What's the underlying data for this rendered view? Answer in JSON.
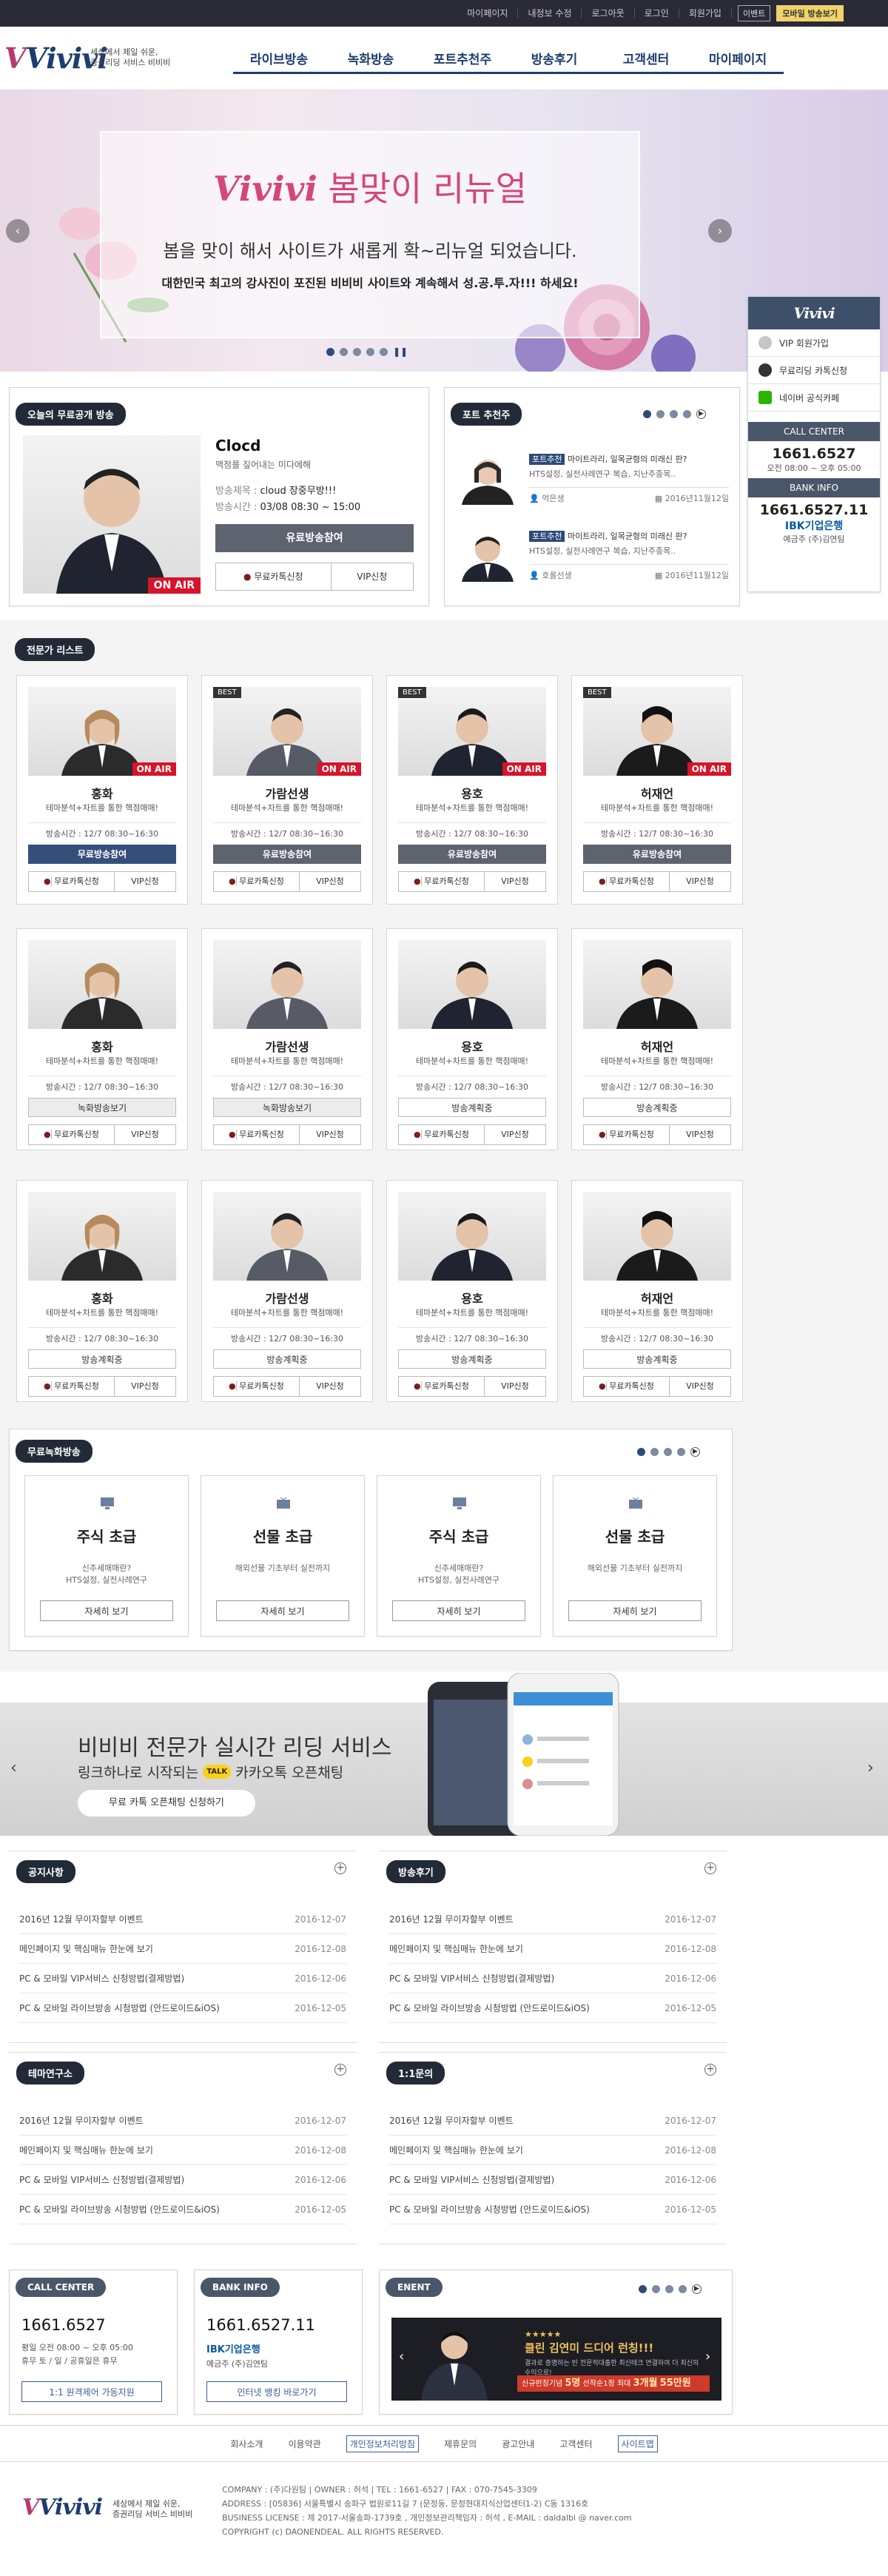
{
  "topbar": {
    "links": [
      "마이페이지",
      "내정보 수정",
      "로그아웃",
      "로그인",
      "회원가입"
    ],
    "event_label": "이벤트",
    "mobile_label": "모바일 방송보기"
  },
  "header": {
    "logo": "Vivivi",
    "tagline_1": "세상에서 제일 쉬운,",
    "tagline_2": "증권리딩 서비스 비비비",
    "nav": [
      "라이브방송",
      "녹화방송",
      "포트추천주",
      "방송후기",
      "고객센터",
      "마이페이지"
    ]
  },
  "banner": {
    "title_brand": "Vivivi",
    "title_rest": "봄맞이 리뉴얼",
    "line1": "봄을 맞이 해서 사이트가 새롭게 확~리뉴얼 되었습니다.",
    "line2": "대한민국 최고의 강사진이 포진된 비비비 사이트와 계속해서 성.공.투.자!!! 하세요!",
    "pause_icon": "pause-icon"
  },
  "quick": {
    "logo": "Vivivi",
    "items": [
      "VIP 회원가입",
      "무료리딩 카톡신청",
      "네이버 공식카페"
    ],
    "call_center_label": "CALL CENTER",
    "call_number": "1661.6527",
    "call_hours": "오전 08:00 ~ 오후 05:00",
    "bank_label": "BANK INFO",
    "bank_number": "1661.6527.11",
    "bank_name": "IBK기업은행",
    "bank_holder_label": "예금주",
    "bank_holder": "(주)김연팀"
  },
  "free_live": {
    "heading": "오늘의 무료공개 방송",
    "name": "Clocd",
    "desc": "맥점를 짚어내는 미다에해",
    "title_label": "방송제목 : ",
    "title_value": "cloud 장중무방!!!",
    "time_label": "방송시간 : ",
    "time_value": "03/08  08:30 ~ 15:00",
    "onair": "ON AIR",
    "join_button": "유료방송참여",
    "kakao_button": "무료카톡신청",
    "vip_button": "VIP신청"
  },
  "port": {
    "heading": "포트 추천주",
    "items": [
      {
        "tag": "포트추천",
        "title": "마이트라리, 일목균형의 미래신 판?",
        "sub": "HTS설정, 실전사례연구 복습, 지난주종목..",
        "author": "먹은생",
        "date": "2016년11월12일"
      },
      {
        "tag": "포트추천",
        "title": "마이트라리, 일목균형의 미래신 판?",
        "sub": "HTS설정, 실전사례연구 복습, 지난주종목..",
        "author": "호롤선생",
        "date": "2016년11월12일"
      }
    ]
  },
  "experts": {
    "heading": "전문가 리스트",
    "desc": "테마분석+차트를 통한 핵점매매!",
    "time": "방송시간 : 12/7 08:30~16:30",
    "kakao": "무료카톡신청",
    "vip": "VIP신청",
    "best": "BEST",
    "onair": "ON AIR",
    "rows": [
      [
        {
          "name": "홍화",
          "button": "무료방송참여",
          "style": "navy",
          "onair": true,
          "best": false
        },
        {
          "name": "가람선생",
          "button": "유료방송참여",
          "style": "dark",
          "onair": true,
          "best": true
        },
        {
          "name": "용호",
          "button": "유료방송참여",
          "style": "dark",
          "onair": true,
          "best": true
        },
        {
          "name": "허재언",
          "button": "유료방송참여",
          "style": "dark",
          "onair": true,
          "best": true
        }
      ],
      [
        {
          "name": "홍화",
          "button": "녹화방송보기",
          "style": "ghost",
          "onair": false,
          "best": false
        },
        {
          "name": "가람선생",
          "button": "녹화방송보기",
          "style": "ghost",
          "onair": false,
          "best": false
        },
        {
          "name": "용호",
          "button": "방송계획중",
          "style": "line",
          "onair": false,
          "best": false
        },
        {
          "name": "허재언",
          "button": "방송계획중",
          "style": "line",
          "onair": false,
          "best": false
        }
      ],
      [
        {
          "name": "홍화",
          "button": "방송계획중",
          "style": "line",
          "onair": false,
          "best": false
        },
        {
          "name": "가람선생",
          "button": "방송계획중",
          "style": "line",
          "onair": false,
          "best": false
        },
        {
          "name": "용호",
          "button": "방송계획중",
          "style": "line",
          "onair": false,
          "best": false
        },
        {
          "name": "허재언",
          "button": "방송계획중",
          "style": "line",
          "onair": false,
          "best": false
        }
      ]
    ]
  },
  "recorded": {
    "heading": "무료녹화방송",
    "items": [
      {
        "title": "주식 초급",
        "d1": "신추세매매란?",
        "d2": "HTS설정, 실전사례연구",
        "button": "자세히 보기"
      },
      {
        "title": "선물 초급",
        "d1": "해외선물 기초부터 실전까지",
        "d2": "",
        "button": "자세히 보기"
      },
      {
        "title": "주식 초급",
        "d1": "신추세매매란?",
        "d2": "HTS설정, 실전사례연구",
        "button": "자세히 보기"
      },
      {
        "title": "선물 초급",
        "d1": "해외선물 기초부터 실전까지",
        "d2": "",
        "button": "자세히 보기"
      }
    ]
  },
  "promo": {
    "title": "비비비 전문가 실시간 리딩 서비스",
    "sub_pre": "링크하나로 시작되는",
    "talk": "TALK",
    "sub_post": "카카오톡 오픈채팅",
    "button": "무료 카톡 오픈채팅 신청하기"
  },
  "boards": [
    {
      "title": "공지사항",
      "rows": [
        [
          "2016년 12월 무이자할부 이벤트",
          "2016-12-07"
        ],
        [
          "메인페이지 및 핵심매뉴 한눈에 보기",
          "2016-12-08"
        ],
        [
          "PC & 모바일 VIP서비스 신청방법(결제방법)",
          "2016-12-06"
        ],
        [
          "PC & 모바일 라이브방송 시청방법 (안드로이드&iOS)",
          "2016-12-05"
        ]
      ]
    },
    {
      "title": "방송후기",
      "rows": [
        [
          "2016년 12월 무이자할부 이벤트",
          "2016-12-07"
        ],
        [
          "메인페이지 및 핵심매뉴 한눈에 보기",
          "2016-12-08"
        ],
        [
          "PC & 모바일 VIP서비스 신청방법(결제방법)",
          "2016-12-06"
        ],
        [
          "PC & 모바일 라이브방송 시청방법 (안드로이드&iOS)",
          "2016-12-05"
        ]
      ]
    },
    {
      "title": "테마연구소",
      "rows": [
        [
          "2016년 12월 무이자할부 이벤트",
          "2016-12-07"
        ],
        [
          "메인페이지 및 핵심매뉴 한눈에 보기",
          "2016-12-08"
        ],
        [
          "PC & 모바일 VIP서비스 신청방법(결제방법)",
          "2016-12-06"
        ],
        [
          "PC & 모바일 라이브방송 시청방법 (안드로이드&iOS)",
          "2016-12-05"
        ]
      ]
    },
    {
      "title": "1:1문의",
      "rows": [
        [
          "2016년 12월 무이자할부 이벤트",
          "2016-12-07"
        ],
        [
          "메인페이지 및 핵심매뉴 한눈에 보기",
          "2016-12-08"
        ],
        [
          "PC & 모바일 VIP서비스 신청방법(결제방법)",
          "2016-12-06"
        ],
        [
          "PC & 모바일 라이브방송 시청방법 (안드로이드&iOS)",
          "2016-12-05"
        ]
      ]
    }
  ],
  "bottom": {
    "call_heading": "CALL CENTER",
    "call_number": "1661.6527",
    "call_hours_1": "평일 오전 08:00 ~ 오후 05:00",
    "call_hours_2": "휴무 토 / 일 / 공휴일은 휴무",
    "call_button": "1:1 원격제어 가동지원",
    "bank_heading": "BANK INFO",
    "bank_number": "1661.6527.11",
    "bank_name": "IBK기업은행",
    "bank_holder_label": "예금주",
    "bank_holder": "(주)김연팀",
    "bank_button": "인터넷 뱅킹 바로가기",
    "event_heading": "ENENT",
    "event_title": "클린 김연미 드디어 런칭!!!",
    "event_sub": "결과로 증명하는 빈 전문적대출한 최신테크 연결하여 더 최신의 수익으로!",
    "event_bar_pre": "신규런칭기념",
    "event_bar_mid": "5명",
    "event_bar_post": "선착순1정 최대",
    "event_bar_months": "3개월",
    "event_bar_price": "55만원"
  },
  "footer": {
    "links": [
      "회사소개",
      "이용약관",
      "개인정보처리방침",
      "제휴문의",
      "광고안내",
      "고객센터",
      "사이트맵"
    ],
    "tag1": "세상에서 제일 쉬운,",
    "tag2": "증권리딩 서비스 비비비",
    "info1": "COMPANY : (주)다원팀  |  OWNER : 허석  |  TEL : 1661-6527  |  FAX : 070-7545-3309",
    "info2": "ADDRESS : [05836] 서울특별시 송파구 법원로11길 7 (문정동, 문정현대지식산업센터1-2) C동 1316호",
    "info3": "BUSINESS LICENSE : 제 2017-서울송파-1739호 , 개인정보관리책임자 : 허석 , E-MAIL : daldalbi @ naver.com",
    "copyright": "COPYRIGHT (c) DAONENDEAL. ALL RIGHTS RESERVED."
  },
  "colors": {
    "navy": "#1c3d70",
    "pink": "#d4467c",
    "dark_bar": "#2a2a36",
    "onair": "#d6142b"
  }
}
